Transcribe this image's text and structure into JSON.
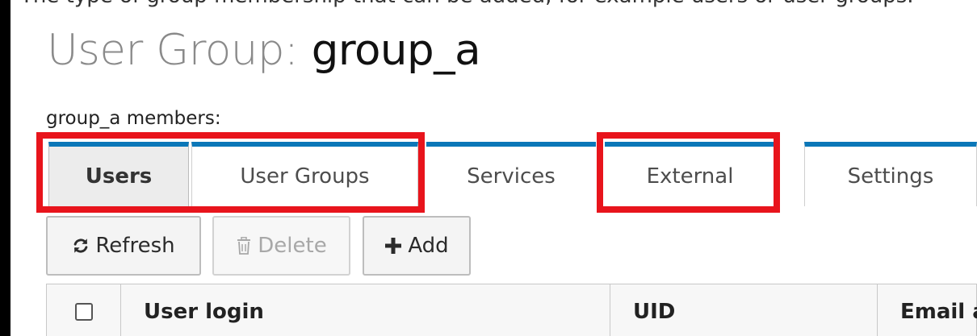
{
  "header": {
    "cut_text": "The type of group membership that can be added, for example users or user groups.",
    "title_prefix": "User Group: ",
    "title_name": "group_a"
  },
  "members_label": "group_a members:",
  "tabs": [
    {
      "label": "Users",
      "active": true,
      "highlighted": true
    },
    {
      "label": "User Groups",
      "active": false,
      "highlighted": true
    },
    {
      "label": "Services",
      "active": false,
      "highlighted": false
    },
    {
      "label": "External",
      "active": false,
      "highlighted": true
    },
    {
      "label": "Settings",
      "active": false,
      "highlighted": false
    }
  ],
  "toolbar": {
    "refresh_label": "Refresh",
    "delete_label": "Delete",
    "add_label": "Add"
  },
  "table": {
    "columns": [
      "User login",
      "UID",
      "Email address"
    ]
  },
  "icons": {
    "refresh": "refresh-icon",
    "delete": "trash-icon",
    "add": "plus-icon"
  },
  "colors": {
    "tab_accent": "#0b77b8",
    "highlight": "#e8141c"
  }
}
